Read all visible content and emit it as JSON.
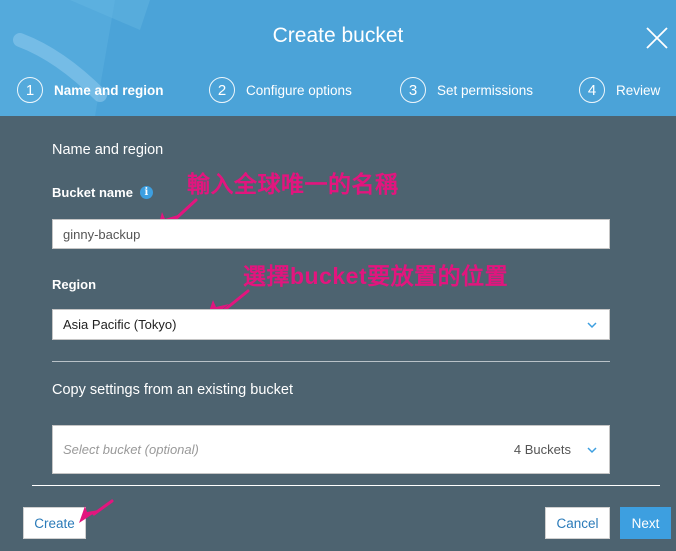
{
  "dialog": {
    "title": "Create bucket"
  },
  "steps": [
    {
      "number": "1",
      "label": "Name and region",
      "active": true
    },
    {
      "number": "2",
      "label": "Configure options",
      "active": false
    },
    {
      "number": "3",
      "label": "Set permissions",
      "active": false
    },
    {
      "number": "4",
      "label": "Review",
      "active": false
    }
  ],
  "form": {
    "section_title": "Name and region",
    "bucket_name_label": "Bucket name",
    "bucket_name_value": "ginny-backup",
    "region_label": "Region",
    "region_value": "Asia Pacific (Tokyo)",
    "copy_settings_title": "Copy settings from an existing bucket",
    "select_bucket_placeholder": "Select bucket (optional)",
    "bucket_count": "4 Buckets"
  },
  "annotations": {
    "bucket_name_note": "輸入全球唯一的名稱",
    "region_note": "選擇bucket要放置的位置"
  },
  "buttons": {
    "create": "Create",
    "cancel": "Cancel",
    "next": "Next"
  },
  "icons": {
    "info": "info-icon",
    "close": "close-icon",
    "chevron": "chevron-down-icon"
  },
  "colors": {
    "header_bg": "#4ba3d8",
    "body_bg": "#4d6370",
    "annotation": "#e2157e",
    "primary_button": "#3d9fe0"
  }
}
